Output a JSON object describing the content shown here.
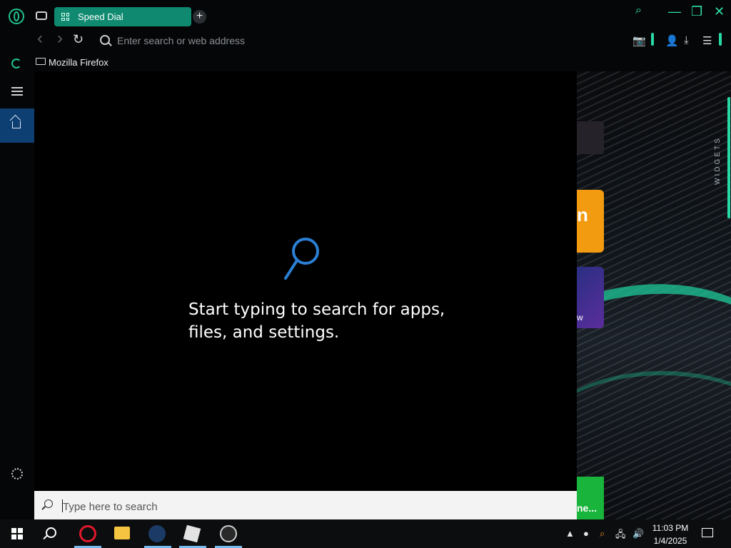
{
  "browser": {
    "tab_label": "Speed Dial",
    "new_tab_symbol": "+",
    "address_placeholder": "Enter search or web address",
    "bookmark_folder": "Mozilla Firefox",
    "widgets_label": "WIDGETS",
    "accent_color": "#27d9a5"
  },
  "search_panel": {
    "hint_line1": "Start typing to search for apps,",
    "hint_line2": "files, and settings.",
    "search_placeholder": "Type here to search"
  },
  "background_tiles": {
    "tile2_text": "n",
    "tile3_text": "w",
    "tile4_text": "ne..."
  },
  "taskbar": {
    "time": "11:03 PM",
    "date": "1/4/2025",
    "apps": [
      "opera-icon",
      "file-explorer-icon",
      "steam-icon",
      "roblox-icon",
      "obs-icon"
    ]
  },
  "icons": {
    "window_minimize": "—",
    "window_restore": "❐",
    "window_close": "✕",
    "back": "‹",
    "forward": "›",
    "reload": "↻",
    "camera": "📷",
    "account": "👤",
    "download": "⤓",
    "easy_setup": "☰",
    "find": "⌕",
    "speaker": "🔊",
    "network": "🖧",
    "up_arrow": "^"
  }
}
